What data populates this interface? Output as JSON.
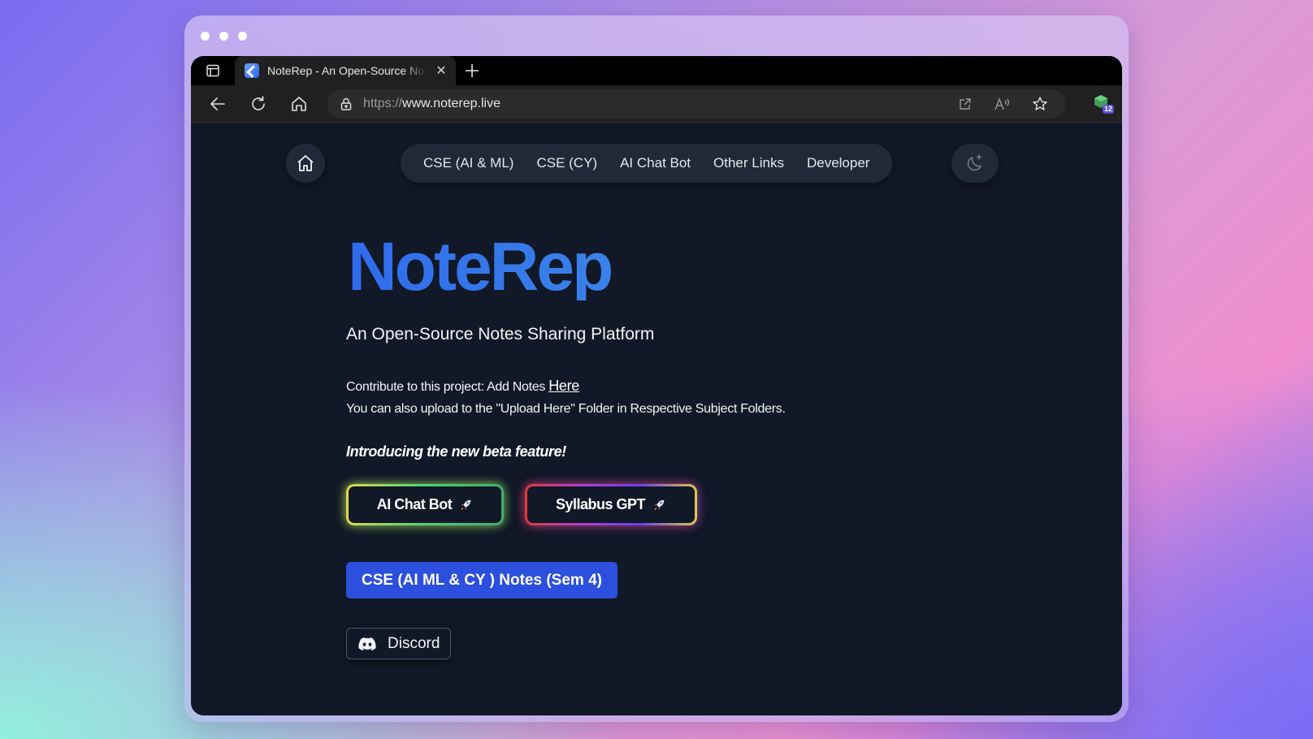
{
  "browser": {
    "tab_title": "NoteRep - An Open-Source Notes Sharing Platform",
    "url_prefix": "https://",
    "url_domain": "www.noterep.live",
    "extension_badge": "12"
  },
  "nav": {
    "links": [
      "CSE (AI & ML)",
      "CSE (CY)",
      "AI Chat Bot",
      "Other Links",
      "Developer"
    ]
  },
  "hero": {
    "logo": "NoteRep",
    "tagline": "An Open-Source Notes Sharing Platform",
    "contribute_text": "Contribute to this project: Add Notes ",
    "contribute_link": "Here",
    "upload_text": "You can also upload to the \"Upload Here\" Folder in Respective Subject Folders.",
    "intro": "Introducing the new beta feature!"
  },
  "buttons": {
    "chat_bot": "AI Chat Bot",
    "syllabus_gpt": "Syllabus GPT",
    "notes": "CSE (AI ML & CY ) Notes (Sem 4)",
    "discord": "Discord"
  },
  "colors": {
    "page_bg": "#111827",
    "accent_blue": "#2c4fde",
    "logo_gradient_start": "#2f6bec",
    "logo_gradient_end": "#56b8e8"
  }
}
